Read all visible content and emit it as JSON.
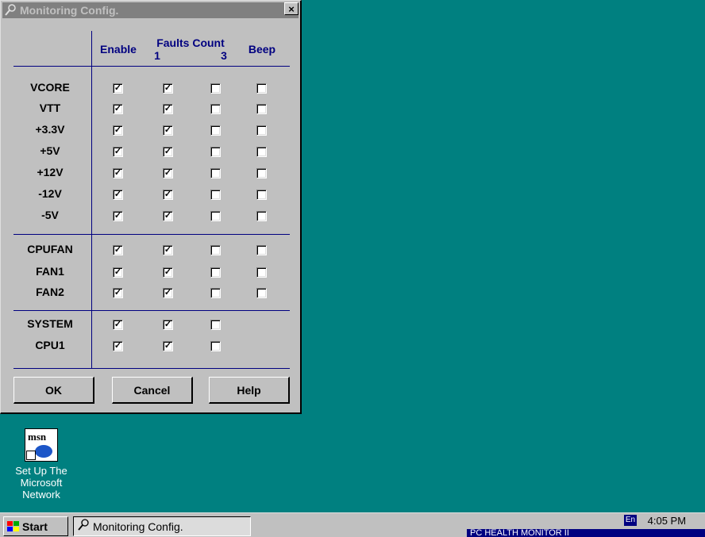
{
  "window": {
    "title": "Monitoring Config.",
    "close_label": "×"
  },
  "headers": {
    "enable": "Enable",
    "faults_count": "Faults Count",
    "fault_1": "1",
    "fault_3": "3",
    "beep": "Beep"
  },
  "groups": [
    {
      "rows": [
        {
          "label": "VCORE",
          "enable": true,
          "f1": true,
          "f3": false,
          "beep": false
        },
        {
          "label": "VTT",
          "enable": true,
          "f1": true,
          "f3": false,
          "beep": false
        },
        {
          "label": "+3.3V",
          "enable": true,
          "f1": true,
          "f3": false,
          "beep": false
        },
        {
          "label": "+5V",
          "enable": true,
          "f1": true,
          "f3": false,
          "beep": false
        },
        {
          "label": "+12V",
          "enable": true,
          "f1": true,
          "f3": false,
          "beep": false
        },
        {
          "label": "-12V",
          "enable": true,
          "f1": true,
          "f3": false,
          "beep": false
        },
        {
          "label": "-5V",
          "enable": true,
          "f1": true,
          "f3": false,
          "beep": false
        }
      ]
    },
    {
      "rows": [
        {
          "label": "CPUFAN",
          "enable": true,
          "f1": true,
          "f3": false,
          "beep": false
        },
        {
          "label": "FAN1",
          "enable": true,
          "f1": true,
          "f3": false,
          "beep": false
        },
        {
          "label": "FAN2",
          "enable": true,
          "f1": true,
          "f3": false,
          "beep": false
        }
      ]
    },
    {
      "rows": [
        {
          "label": "SYSTEM",
          "enable": true,
          "f1": true,
          "f3": false,
          "beep": null
        },
        {
          "label": "CPU1",
          "enable": true,
          "f1": true,
          "f3": false,
          "beep": null
        }
      ]
    }
  ],
  "buttons": {
    "ok": "OK",
    "cancel": "Cancel",
    "help": "Help"
  },
  "desktop": {
    "msn_icon_text": "msn",
    "msn_label": "Set Up The Microsoft Network"
  },
  "taskbar": {
    "start": "Start",
    "task": "Monitoring Config.",
    "clock": "4:05 PM",
    "tooltip": "PC HEALTH MONITOR II"
  },
  "colors": {
    "desktop": "#008080",
    "face": "#c0c0c0",
    "header_text": "#000080",
    "title_inactive": "#808080"
  }
}
